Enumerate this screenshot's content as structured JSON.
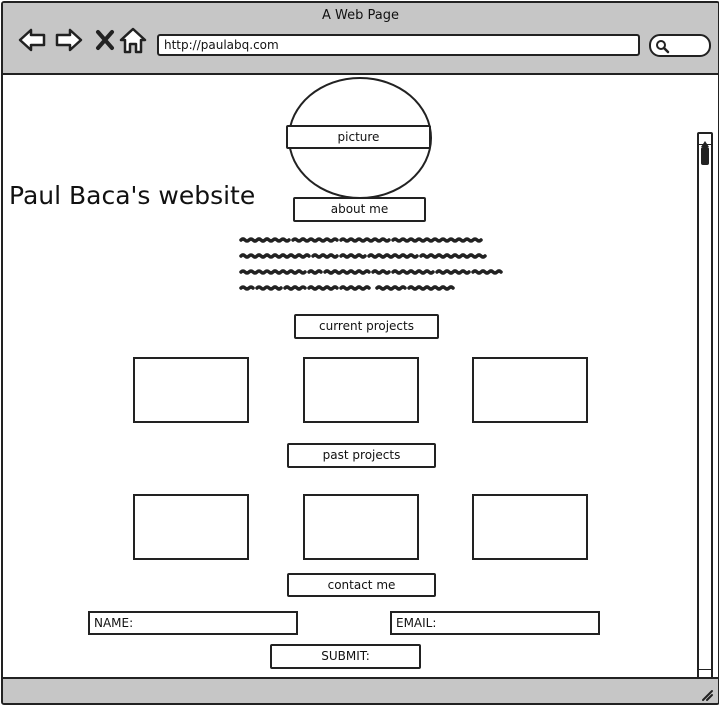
{
  "window": {
    "title": "A Web Page"
  },
  "address_bar": {
    "url": "http://paulabq.com"
  },
  "toolbar": {
    "icons": [
      "back-arrow-icon",
      "forward-arrow-icon",
      "close-x-icon",
      "home-icon",
      "search-icon"
    ]
  },
  "page": {
    "picture_label": "picture",
    "site_title": "Paul Baca's website",
    "about_label": "about me",
    "current_projects_label": "current projects",
    "past_projects_label": "past projects",
    "contact_label": "contact me",
    "name_placeholder": "NAME:",
    "email_placeholder": "EMAIL:",
    "submit_label": "SUBMIT:"
  },
  "colors": {
    "chrome": "#c6c6c6",
    "ink": "#222222",
    "background": "#ffffff"
  }
}
